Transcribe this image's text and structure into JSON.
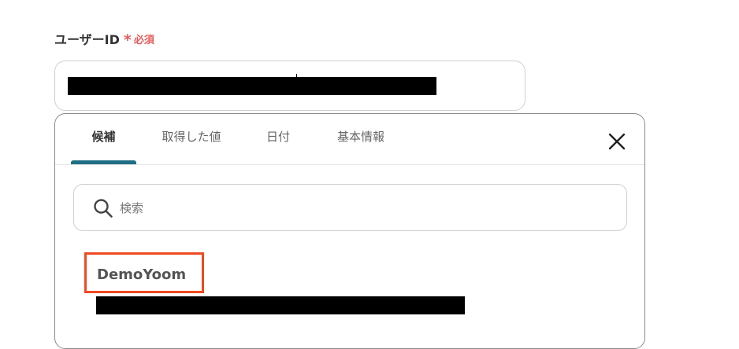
{
  "field": {
    "label": "ユーザーID",
    "required_mark": "*",
    "required_text": "必須"
  },
  "dropdown": {
    "tabs": [
      {
        "label": "候補",
        "active": true
      },
      {
        "label": "取得した値",
        "active": false
      },
      {
        "label": "日付",
        "active": false
      },
      {
        "label": "基本情報",
        "active": false
      }
    ],
    "close_icon": "close-icon",
    "search": {
      "icon": "search-icon",
      "placeholder": "検索",
      "value": ""
    },
    "results": [
      {
        "title": "DemoYoom",
        "highlighted": true
      }
    ]
  },
  "colors": {
    "required": "#e85a5a",
    "tab_active_underline": "#1f6e83",
    "highlight_border": "#ef4a20"
  }
}
